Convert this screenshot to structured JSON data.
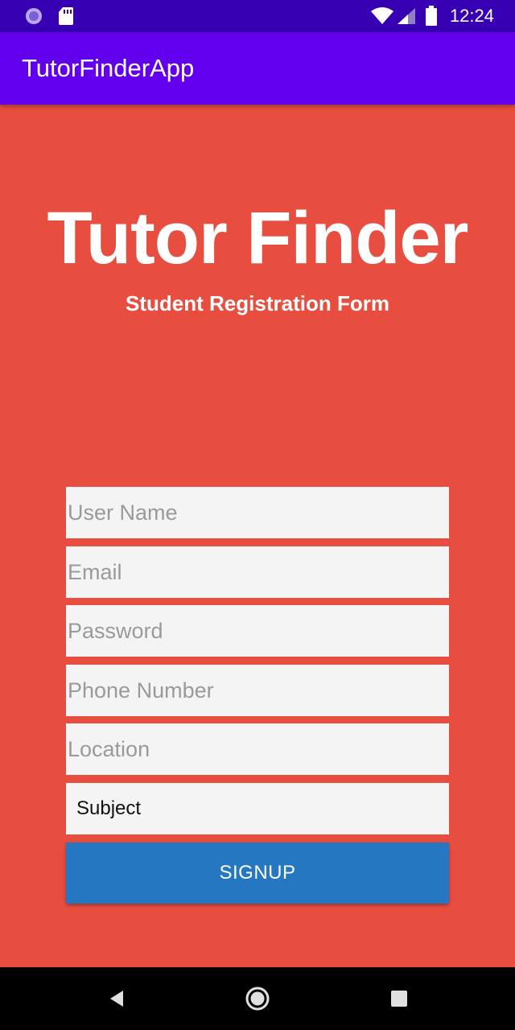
{
  "status_bar": {
    "time": "12:24",
    "icons": [
      "notification-circle-icon",
      "sd-card-icon",
      "wifi-icon",
      "signal-icon",
      "battery-icon"
    ]
  },
  "app_bar": {
    "title": "TutorFinderApp"
  },
  "hero": {
    "title": "Tutor Finder",
    "subtitle": "Student Registration Form"
  },
  "form": {
    "username_placeholder": "User Name",
    "email_placeholder": "Email",
    "password_placeholder": "Password",
    "phone_placeholder": "Phone Number",
    "location_placeholder": "Location",
    "subject_value": "Subject",
    "signup_label": "SIGNUP"
  },
  "nav_bar": {
    "icons": [
      "back-icon",
      "home-icon",
      "recents-icon"
    ]
  },
  "colors": {
    "status_bar": "#3700b3",
    "app_bar": "#6200ee",
    "background": "#e84e3f",
    "button": "#2677c2",
    "field": "#f4f4f4"
  }
}
